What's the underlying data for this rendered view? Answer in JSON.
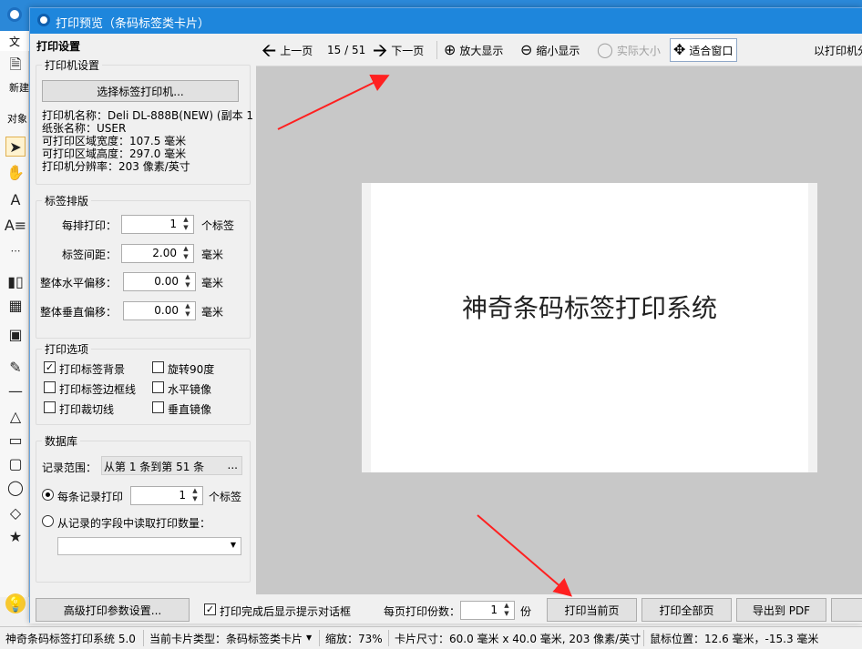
{
  "app": {
    "menu_file": "文件",
    "toolbox_new": "新建",
    "toolbox_object": "对象"
  },
  "dialog": {
    "title": "打印预览（条码标签类卡片）"
  },
  "settings": {
    "title": "打印设置",
    "printer_group": {
      "label": "打印机设置",
      "select_button": "选择标签打印机...",
      "info": [
        "打印机名称：Deli DL-888B(NEW) (副本 1",
        "纸张名称：USER",
        "可打印区域宽度：107.5 毫米",
        "可打印区域高度：297.0 毫米",
        "打印机分辨率：203 像素/英寸"
      ]
    },
    "layout_group": {
      "label": "标签排版",
      "rows": [
        {
          "label": "每排打印：",
          "value": "1",
          "unit": "个标签"
        },
        {
          "label": "标签间距：",
          "value": "2.00",
          "unit": "毫米"
        },
        {
          "label": "整体水平偏移：",
          "value": "0.00",
          "unit": "毫米"
        },
        {
          "label": "整体垂直偏移：",
          "value": "0.00",
          "unit": "毫米"
        }
      ]
    },
    "options_group": {
      "label": "打印选项",
      "print_bg": {
        "label": "打印标签背景",
        "checked": true
      },
      "rotate90": {
        "label": "旋转90度",
        "checked": false
      },
      "print_border": {
        "label": "打印标签边框线",
        "checked": false
      },
      "mirror_h": {
        "label": "水平镜像",
        "checked": false
      },
      "print_cut": {
        "label": "打印裁切线",
        "checked": false
      },
      "mirror_v": {
        "label": "垂直镜像",
        "checked": false
      }
    },
    "db_group": {
      "label": "数据库",
      "range_label": "记录范围：",
      "range_value": "从第 1 条到第 51 条",
      "range_btn": "...",
      "per_record_label": "每条记录打印",
      "per_record_value": "1",
      "per_record_unit": "个标签",
      "from_field_label": "从记录的字段中读取打印数量："
    }
  },
  "toolbar": {
    "prev": "上一页",
    "page_indicator": "15 / 51",
    "next": "下一页",
    "zoom_in": "放大显示",
    "zoom_out": "缩小显示",
    "actual_size": "实际大小",
    "fit_window": "适合窗口",
    "right_text": "以打印机分"
  },
  "preview": {
    "label_text": "神奇条码标签打印系统"
  },
  "bottom": {
    "advanced_btn": "高级打印参数设置...",
    "show_prompt_label": "打印完成后显示提示对话框",
    "show_prompt_checked": true,
    "copies_label": "每页打印份数：",
    "copies_value": "1",
    "copies_unit": "份",
    "print_current": "打印当前页",
    "print_all": "打印全部页",
    "export_pdf": "导出到 PDF"
  },
  "statusbar": {
    "app_name": "神奇条码标签打印系统 5.0",
    "card_type": "当前卡片类型：条码标签类卡片",
    "zoom": "缩放：73%",
    "card_size": "卡片尺寸：60.0 毫米 x 40.0 毫米, 203 像素/英寸",
    "mouse_pos": "鼠标位置：12.6 毫米，-15.3 毫米"
  },
  "colors": {
    "accent": "#1e86dc",
    "annotation_arrow": "#ff2020"
  }
}
